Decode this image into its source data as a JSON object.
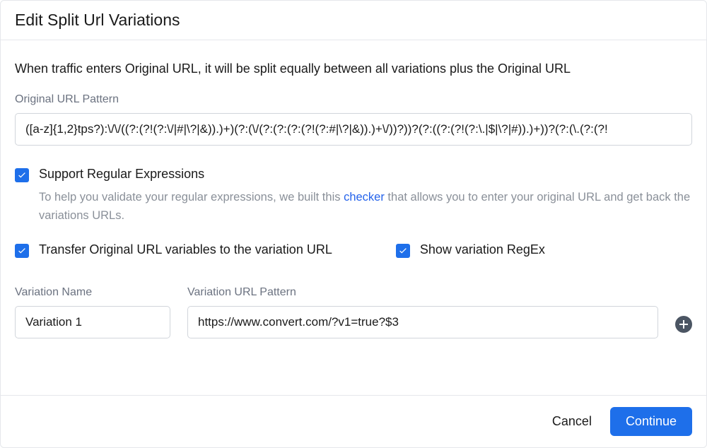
{
  "header": {
    "title": "Edit Split Url Variations"
  },
  "intro": "When traffic enters Original URL, it will be split equally between all variations plus the Original URL",
  "original_url": {
    "label": "Original URL Pattern",
    "value": "([a-z]{1,2}tps?):\\/\\/((?:(?!(?:\\/|#|\\?|&)).)+)(?:(\\/(?:(?:(?:(?!(?:#|\\?|&)).)+\\/))?))?(?:((?:(?!(?:\\.|$|\\?|#)).)+))?(?:(\\.(?:(?!"
  },
  "checkboxes": {
    "regex": {
      "label": "Support Regular Expressions",
      "checked": true,
      "help_prefix": "To help you validate your regular expressions, we built this ",
      "help_link": "checker",
      "help_suffix": " that allows you to enter your original URL and get back the variations URLs."
    },
    "transfer": {
      "label": "Transfer Original URL variables to the variation URL",
      "checked": true
    },
    "show_regex": {
      "label": "Show variation RegEx",
      "checked": true
    }
  },
  "variation": {
    "name_label": "Variation Name",
    "url_label": "Variation URL Pattern",
    "name_value": "Variation 1",
    "url_value": "https://www.convert.com/?v1=true?$3"
  },
  "footer": {
    "cancel": "Cancel",
    "continue": "Continue"
  }
}
